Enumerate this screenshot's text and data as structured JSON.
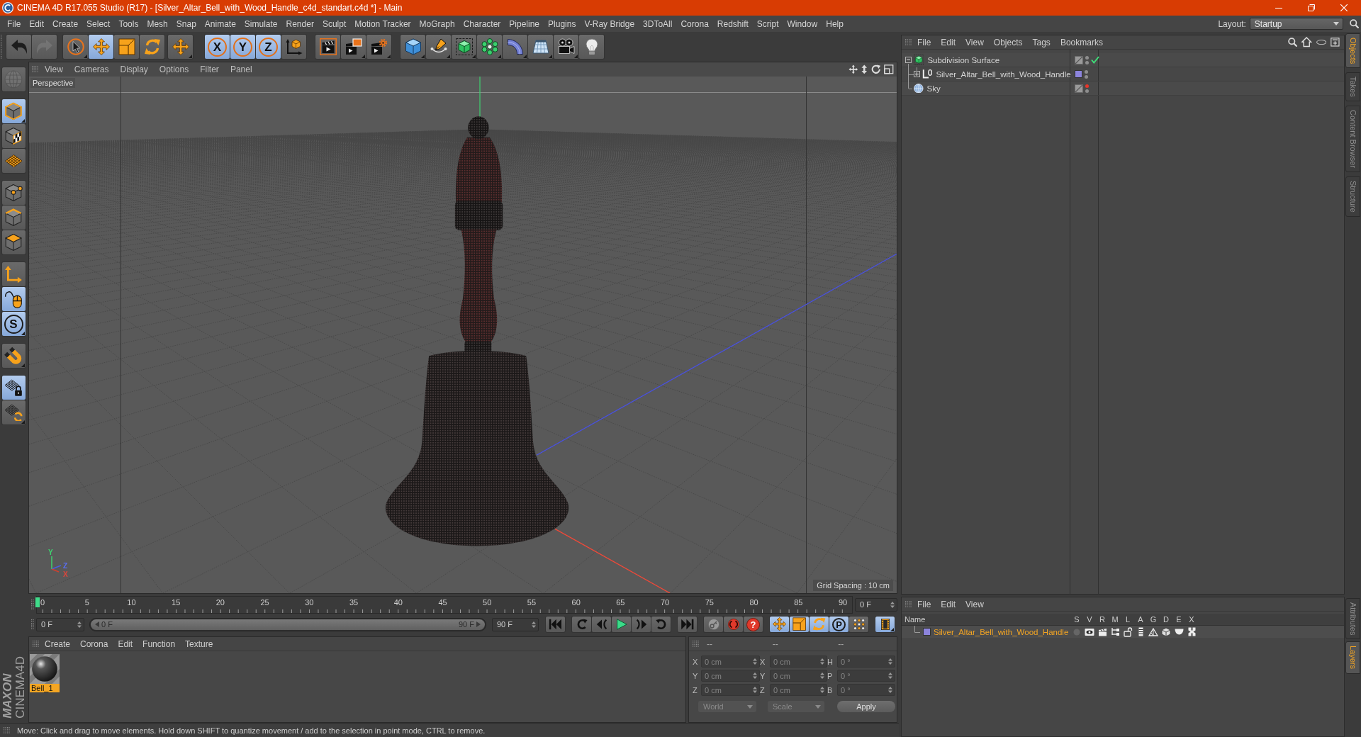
{
  "window": {
    "title": "CINEMA 4D R17.055 Studio (R17) - [Silver_Altar_Bell_with_Wood_Handle_c4d_standart.c4d *] - Main"
  },
  "menu_bar": {
    "items": [
      "File",
      "Edit",
      "Create",
      "Select",
      "Tools",
      "Mesh",
      "Snap",
      "Animate",
      "Simulate",
      "Render",
      "Sculpt",
      "Motion Tracker",
      "MoGraph",
      "Character",
      "Pipeline",
      "Plugins",
      "V-Ray Bridge",
      "3DToAll",
      "Corona",
      "Redshift",
      "Script",
      "Window",
      "Help"
    ],
    "layout_label": "Layout:",
    "layout_value": "Startup"
  },
  "toolbar": {
    "groups": [
      [
        {
          "selected": false,
          "disabled": false
        },
        {
          "selected": false,
          "disabled": true
        }
      ],
      [
        {
          "selected": false,
          "disabled": false
        },
        {
          "selected": true,
          "disabled": false
        },
        {
          "selected": false,
          "disabled": false
        },
        {
          "selected": false,
          "disabled": false
        }
      ],
      [
        {
          "selected": false,
          "disabled": false
        }
      ],
      [
        {
          "label": "X",
          "selected": true,
          "disabled": false
        },
        {
          "label": "Y",
          "selected": true,
          "disabled": false
        },
        {
          "label": "Z",
          "selected": true,
          "disabled": false
        },
        {
          "selected": false,
          "disabled": false
        }
      ],
      [
        {
          "selected": false,
          "disabled": false
        },
        {
          "selected": false,
          "disabled": false
        },
        {
          "selected": false,
          "disabled": false
        }
      ],
      [
        {
          "selected": false,
          "disabled": false
        },
        {
          "selected": false,
          "disabled": false
        },
        {
          "selected": false,
          "disabled": false
        },
        {
          "selected": false,
          "disabled": false
        },
        {
          "selected": false,
          "disabled": false
        },
        {
          "selected": false,
          "disabled": false
        },
        {
          "selected": false,
          "disabled": false
        },
        {
          "selected": false,
          "disabled": false
        }
      ]
    ]
  },
  "left_toolbar": {
    "groups": [
      [
        {
          "selected": false,
          "disabled": true
        }
      ],
      [
        {
          "selected": true,
          "disabled": false
        },
        {
          "selected": false,
          "disabled": false
        },
        {
          "selected": false,
          "disabled": false
        }
      ],
      [
        {
          "selected": false,
          "disabled": false
        },
        {
          "selected": false,
          "disabled": false
        },
        {
          "selected": false,
          "disabled": false
        }
      ],
      [
        {
          "selected": false,
          "disabled": false
        },
        {
          "selected": true,
          "disabled": false
        },
        {
          "label": "S",
          "selected": true,
          "disabled": false
        }
      ],
      [
        {
          "selected": false,
          "disabled": false
        }
      ],
      [
        {
          "selected": true,
          "disabled": false
        },
        {
          "selected": false,
          "disabled": false
        }
      ]
    ]
  },
  "viewport": {
    "menu": [
      "View",
      "Cameras",
      "Display",
      "Options",
      "Filter",
      "Panel"
    ],
    "camera": "Perspective",
    "grid_spacing": "Grid Spacing : 10 cm",
    "gizmo_labels": [
      "Y",
      "Z",
      "X"
    ]
  },
  "timeline": {
    "ruler_labels": [
      "0",
      "5",
      "10",
      "15",
      "20",
      "25",
      "30",
      "35",
      "40",
      "45",
      "50",
      "55",
      "60",
      "65",
      "70",
      "75",
      "80",
      "85",
      "90"
    ],
    "level": 0,
    "current_frame": "0 F",
    "start_frame": "0 F",
    "range": {
      "start": "0 F",
      "end": "90 F",
      "level": 1
    },
    "end_frame": "90 F",
    "transport": {
      "groups": [
        [
          {
            "selected": false
          }
        ],
        [
          {
            "selected": false
          },
          {
            "selected": false
          },
          {
            "selected": false
          },
          {
            "selected": false
          },
          {
            "selected": false
          }
        ],
        [
          {
            "selected": false
          }
        ],
        [
          {
            "selected": false
          },
          {
            "selected": false
          },
          {
            "label": "?",
            "selected": false
          }
        ],
        [
          {
            "selected": true
          },
          {
            "selected": true
          },
          {
            "selected": true
          },
          {
            "label": "P",
            "selected": true
          },
          {
            "selected": false
          }
        ],
        [
          {
            "selected": true
          }
        ]
      ]
    }
  },
  "materials": {
    "menu": [
      "Create",
      "Corona",
      "Edit",
      "Function",
      "Texture"
    ],
    "items": [
      {
        "name": "Bell_1",
        "selected": true
      }
    ]
  },
  "coordinates": {
    "disabled": true,
    "headers": [
      "--",
      "--",
      "--"
    ],
    "rows": [
      {
        "position_axis": "X",
        "position": "0 cm",
        "size_axis": "X",
        "size": "0 cm",
        "rotation_axis": "H",
        "rotation": "0 °"
      },
      {
        "position_axis": "Y",
        "position": "0 cm",
        "size_axis": "Y",
        "size": "0 cm",
        "rotation_axis": "P",
        "rotation": "0 °"
      },
      {
        "position_axis": "Z",
        "position": "0 cm",
        "size_axis": "Z",
        "size": "0 cm",
        "rotation_axis": "B",
        "rotation": "0 °"
      }
    ],
    "mode": "World",
    "transform": "Scale",
    "apply": "Apply"
  },
  "status_bar": {
    "text": "Move: Click and drag to move elements. Hold down SHIFT to quantize movement / add to the selection in point mode, CTRL to remove."
  },
  "logo": {
    "brand": "MAXON",
    "product": "CINEMA4D"
  },
  "object_manager": {
    "menu": [
      "File",
      "Edit",
      "View",
      "Objects",
      "Tags",
      "Bookmarks"
    ],
    "objects": [
      {
        "name": "Subdivision Surface",
        "kind": "generator",
        "expanded": true,
        "enabled": true,
        "editor_hidden": false,
        "render_hidden": false,
        "children": [
          {
            "name": "Silver_Altar_Bell_with_Wood_Handle",
            "kind": "null",
            "expanded": false,
            "color": "#8c84dc",
            "editor_hidden": false,
            "render_hidden": false
          }
        ]
      },
      {
        "name": "Sky",
        "kind": "sky",
        "editor_hidden": true,
        "render_hidden": false
      }
    ]
  },
  "layer_manager": {
    "menu": [
      "File",
      "Edit",
      "View"
    ],
    "columns": [
      "Name",
      "S",
      "V",
      "R",
      "M",
      "L",
      "A",
      "G",
      "D",
      "E",
      "X"
    ],
    "layers": [
      {
        "name": "Silver_Altar_Bell_with_Wood_Handle",
        "color": "#8c84dc",
        "selected": true,
        "flags": [
          {
            "on": false
          },
          {
            "on": true
          },
          {
            "on": true
          },
          {
            "on": true
          },
          {
            "on": true
          },
          {
            "on": true
          },
          {
            "on": true
          },
          {
            "on": true
          },
          {
            "on": true
          },
          {
            "on": true
          }
        ]
      }
    ]
  },
  "side_tabs": {
    "top": [
      {
        "label": "Objects",
        "selected": true
      },
      {
        "label": "Takes",
        "selected": false
      },
      {
        "label": "Content Browser",
        "selected": false
      },
      {
        "label": "Structure",
        "selected": false
      }
    ],
    "bottom": [
      {
        "label": "Attributes",
        "selected": false
      },
      {
        "label": "Layers",
        "selected": true
      }
    ]
  }
}
